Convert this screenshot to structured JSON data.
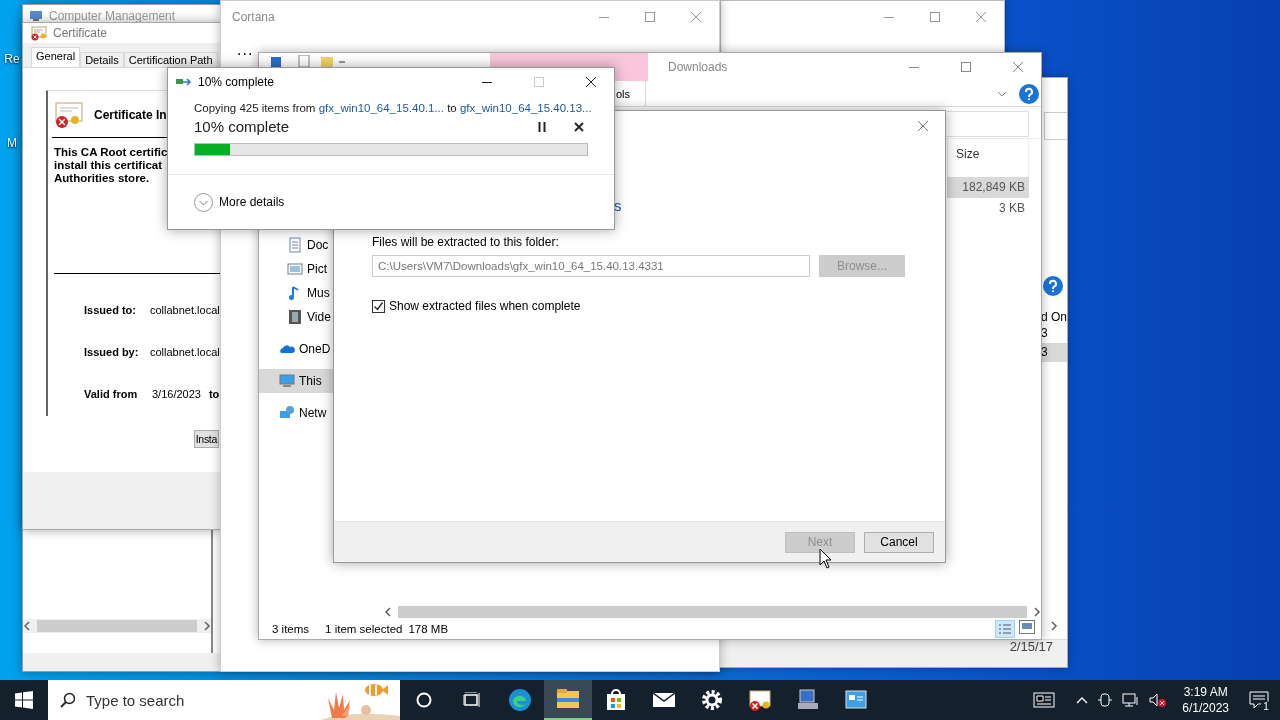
{
  "desktop": {
    "icons": [
      {
        "label": "Re"
      },
      {
        "label": "M"
      }
    ]
  },
  "computer_management": {
    "title": "Computer Management"
  },
  "back_window": {
    "column_header": "d On",
    "cells": [
      {
        "text": "3",
        "selected": false
      },
      {
        "text": "3",
        "selected": true
      }
    ],
    "footer_text": "2/15/17"
  },
  "certificate": {
    "title": "Certificate",
    "tabs": [
      {
        "label": "General",
        "selected": true
      },
      {
        "label": "Details",
        "selected": false
      },
      {
        "label": "Certification Path",
        "selected": false
      }
    ],
    "heading": "Certificate In",
    "message": [
      "This CA Root certific",
      "install this certificat",
      "Authorities store."
    ],
    "fields": [
      {
        "label": "Issued to:",
        "value": "collabnet.local"
      },
      {
        "label": "Issued by:",
        "value": "collabnet.local"
      },
      {
        "label": "Valid from",
        "value": "3/16/2023",
        "suffix": "to"
      }
    ],
    "button": "Insta"
  },
  "cortana": {
    "title": "Cortana",
    "more": "..."
  },
  "explorer": {
    "title": "Downloads",
    "context_tab": "ols",
    "nav": [
      {
        "children": [
          {
            "label": "Doc",
            "kind": "documents",
            "selected": false
          },
          {
            "label": "Pict",
            "kind": "pictures",
            "selected": false
          },
          {
            "label": "Mus",
            "kind": "music",
            "selected": false
          },
          {
            "label": "Vide",
            "kind": "videos",
            "selected": false
          }
        ]
      },
      {
        "label": "OneD",
        "kind": "onedrive",
        "selected": false
      },
      {
        "label": "This",
        "kind": "computer",
        "selected": true
      },
      {
        "label": "Netw",
        "kind": "network",
        "selected": false
      }
    ],
    "column_header": "Size",
    "rows": [
      {
        "size": "182,849 KB",
        "selected": true
      },
      {
        "size": "3 KB",
        "selected": false
      }
    ],
    "status": {
      "count": "3 items",
      "selection": "1 item selected",
      "size": "178 MB"
    }
  },
  "wizard": {
    "heading_fragment": "s",
    "folder_label": "Files will be extracted to this folder:",
    "path": "C:\\Users\\VM7\\Downloads\\gfx_win10_64_15.40.13.4331",
    "browse": {
      "label": "Browse...",
      "disabled": true
    },
    "show_files": {
      "label": "Show extracted files when complete",
      "checked": true
    },
    "buttons": [
      {
        "label": "Next",
        "disabled": true
      },
      {
        "label": "Cancel",
        "disabled": false
      }
    ]
  },
  "copy_dialog": {
    "title": "10% complete",
    "prefix": "Copying 425 items from",
    "source": "gfx_win10_64_15.40.1...",
    "joiner": "to",
    "destination": "gfx_win10_64_15.40.13...",
    "status": "10% complete",
    "level": 0.09,
    "more_details": "More details"
  },
  "taskbar": {
    "search_placeholder": "Type to search",
    "apps": [
      {
        "kind": "edge",
        "selected": false
      },
      {
        "kind": "explorer",
        "selected": true
      },
      {
        "kind": "store",
        "selected": false
      },
      {
        "kind": "mail",
        "selected": false
      },
      {
        "kind": "settings",
        "selected": false
      },
      {
        "kind": "certificate",
        "selected": false
      },
      {
        "kind": "computer",
        "selected": false
      },
      {
        "kind": "control-panel",
        "selected": false
      }
    ],
    "time": "3:19 AM",
    "date": "6/1/2023",
    "notification_count": "1"
  }
}
